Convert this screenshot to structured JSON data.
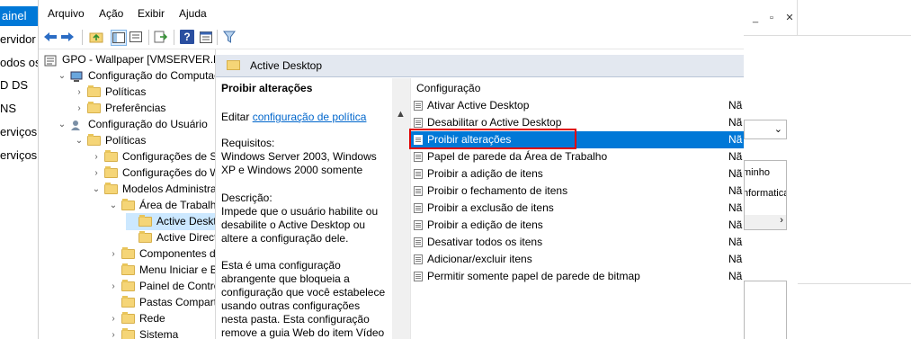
{
  "background_left": {
    "highlighted": "ainel",
    "items": [
      "ervidor",
      "odos os",
      "D DS",
      "NS",
      "erviços",
      "erviços"
    ]
  },
  "menubar": [
    "Arquivo",
    "Ação",
    "Exibir",
    "Ajuda"
  ],
  "toolbar_icons": [
    "back-arrow-icon",
    "forward-arrow-icon",
    "up-folder-icon",
    "show-tree-icon",
    "export-list-icon",
    "help-icon",
    "properties-icon",
    "filter-icon"
  ],
  "tree": [
    {
      "label": "GPO - Wallpaper [VMSERVER.PS",
      "indent": 0,
      "arrow": "",
      "icon": "gpo"
    },
    {
      "label": "Configuração do Computac",
      "indent": 1,
      "arrow": "v",
      "icon": "computer"
    },
    {
      "label": "Políticas",
      "indent": 2,
      "arrow": ">",
      "icon": "folder"
    },
    {
      "label": "Preferências",
      "indent": 2,
      "arrow": ">",
      "icon": "folder"
    },
    {
      "label": "Configuração do Usuário",
      "indent": 1,
      "arrow": "v",
      "icon": "user"
    },
    {
      "label": "Políticas",
      "indent": 2,
      "arrow": "v",
      "icon": "folder"
    },
    {
      "label": "Configurações de So",
      "indent": 3,
      "arrow": ">",
      "icon": "folder"
    },
    {
      "label": "Configurações do W",
      "indent": 3,
      "arrow": ">",
      "icon": "folder"
    },
    {
      "label": "Modelos Administrat",
      "indent": 3,
      "arrow": "v",
      "icon": "folder"
    },
    {
      "label": "Área de Trabalho",
      "indent": 4,
      "arrow": "v",
      "icon": "folder"
    },
    {
      "label": "Active Deskto",
      "indent": 5,
      "arrow": "",
      "icon": "folder",
      "selected": true
    },
    {
      "label": "Active Directo",
      "indent": 5,
      "arrow": "",
      "icon": "folder"
    },
    {
      "label": "Componentes dc",
      "indent": 4,
      "arrow": ">",
      "icon": "folder"
    },
    {
      "label": "Menu Iniciar e Ba",
      "indent": 4,
      "arrow": "",
      "icon": "folder"
    },
    {
      "label": "Painel de Control",
      "indent": 4,
      "arrow": ">",
      "icon": "folder"
    },
    {
      "label": "Pastas Compartil",
      "indent": 4,
      "arrow": "",
      "icon": "folder"
    },
    {
      "label": "Rede",
      "indent": 4,
      "arrow": ">",
      "icon": "folder"
    },
    {
      "label": "Sistema",
      "indent": 4,
      "arrow": ">",
      "icon": "folder"
    }
  ],
  "right_title": "Active Desktop",
  "description": {
    "heading": "Proibir alterações",
    "edit_prefix": "Editar ",
    "edit_link": "configuração de política",
    "req_label": "Requisitos:",
    "req_text": "Windows Server 2003, Windows XP e Windows 2000 somente",
    "desc_label": "Descrição:",
    "desc_text": "Impede que o usuário habilite ou desabilite o Active Desktop ou altere a configuração dele.",
    "extra_text": "Esta é uma configuração abrangente que bloqueia a configuração que você estabelece usando outras configurações nesta pasta. Esta configuração remove a guia Web do item Vídeo"
  },
  "list_header": "Configuração",
  "list_items": [
    {
      "name": "Ativar Active Desktop",
      "state": "Nã"
    },
    {
      "name": "Desabilitar o Active Desktop",
      "state": "Nã"
    },
    {
      "name": "Proibir alterações",
      "state": "Nã",
      "selected": true
    },
    {
      "name": "Papel de parede da Área de Trabalho",
      "state": "Nã"
    },
    {
      "name": "Proibir a adição de itens",
      "state": "Nã"
    },
    {
      "name": "Proibir o fechamento de itens",
      "state": "Nã"
    },
    {
      "name": "Proibir a exclusão de itens",
      "state": "Nã"
    },
    {
      "name": "Proibir a edição de itens",
      "state": "Nã"
    },
    {
      "name": "Desativar todos os itens",
      "state": "Nã"
    },
    {
      "name": "Adicionar/excluir itens",
      "state": "Nã"
    },
    {
      "name": "Permitir somente papel de parede de bitmap",
      "state": "Nã"
    }
  ],
  "right_window": {
    "text1": "minho",
    "text2": "nformatica"
  },
  "colors": {
    "selection": "#0078d7",
    "highlight_box": "#e00000",
    "title_bar": "#e3e8f0"
  }
}
